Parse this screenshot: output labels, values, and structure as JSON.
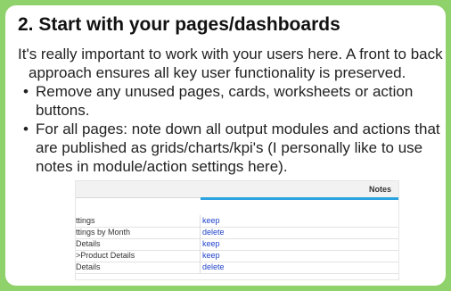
{
  "title": "2. Start with your pages/dashboards",
  "intro": "It's really important to work with your users here. A front to back approach ensures all key user functionality is preserved.",
  "bullets": [
    "Remove any unused pages, cards, worksheets or action buttons.",
    "For all pages: note down all output modules and actions that are published as grids/charts/kpi's (I personally like to use notes in module/action settings here)."
  ],
  "table": {
    "header_notes": "Notes",
    "rows": [
      {
        "name": "ttings",
        "note": "keep"
      },
      {
        "name": "ttings by Month",
        "note": "delete"
      },
      {
        "name": " Details",
        "note": "keep"
      },
      {
        "name": ">Product Details",
        "note": "keep"
      },
      {
        "name": " Details",
        "note": "delete"
      }
    ]
  },
  "colors": {
    "background": "#8fd16a",
    "link": "#2244cc",
    "accent": "#2aa3e0"
  }
}
